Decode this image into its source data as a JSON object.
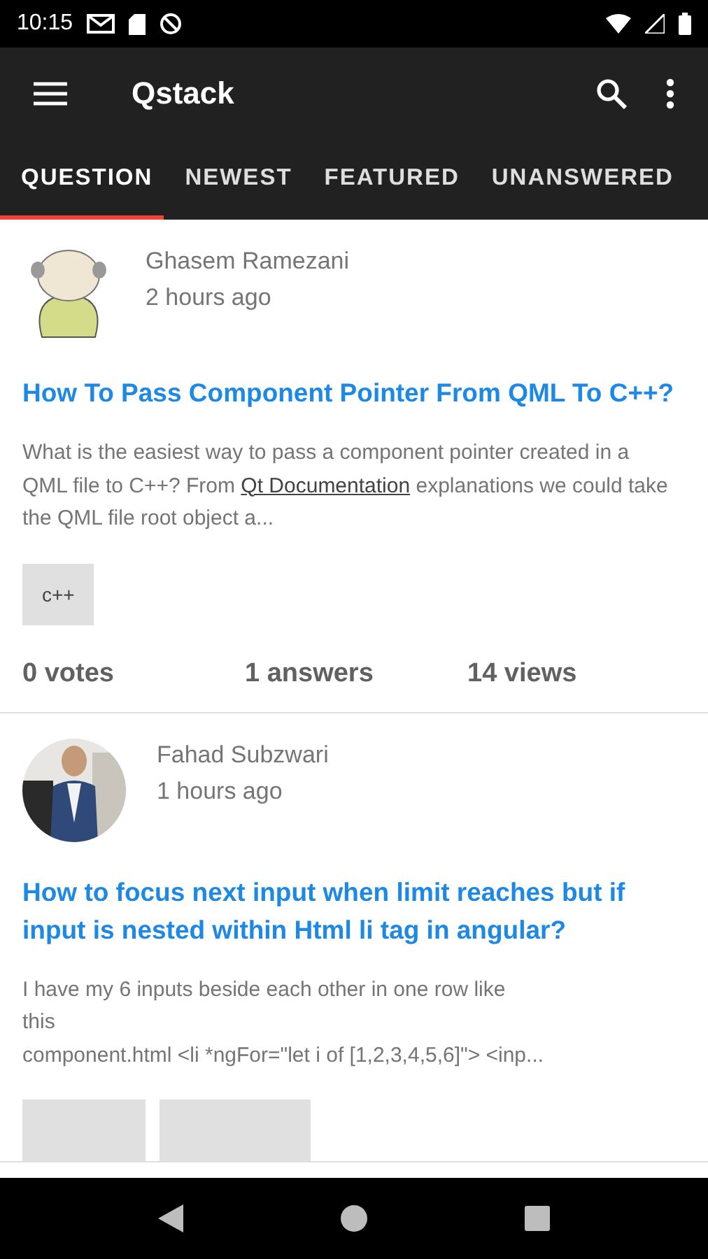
{
  "status_bar": {
    "time": "10:15"
  },
  "app_bar": {
    "title": "Qstack"
  },
  "tabs": [
    {
      "label": "QUESTION",
      "selected": true
    },
    {
      "label": "NEWEST",
      "selected": false
    },
    {
      "label": "FEATURED",
      "selected": false
    },
    {
      "label": "UNANSWERED",
      "selected": false
    }
  ],
  "questions": [
    {
      "avatar": {
        "kind": "cartoon"
      },
      "author": "Ghasem Ramezani",
      "time": "2 hours ago",
      "title": "How To Pass Component Pointer From QML To C++?",
      "excerpt": [
        {
          "kind": "text",
          "text": "What is the easiest way to pass a component pointer created in a QML file to C++? From "
        },
        {
          "kind": "link",
          "text": "Qt Documentation"
        },
        {
          "kind": "text",
          "text": " explanations we could take the QML file root object a..."
        }
      ],
      "tags": [
        {
          "kind": "text",
          "text": "c++"
        }
      ],
      "votes": "0 votes",
      "answers": "1 answers",
      "views": "14 views"
    },
    {
      "avatar": {
        "kind": "picture"
      },
      "author": "Fahad Subzwari",
      "time": "1 hours ago",
      "title": "How to focus next input when limit reaches but if input is nested within Html li tag in angular?",
      "excerpt": [
        {
          "kind": "text",
          "text": "I have my 6 inputs beside each other in one row like\nthis\ncomponent.html <li *ngFor=\"let i of [1,2,3,4,5,6]\"> <inp..."
        }
      ],
      "tags": [
        {
          "kind": "cut"
        },
        {
          "kind": "cut"
        }
      ]
    }
  ]
}
